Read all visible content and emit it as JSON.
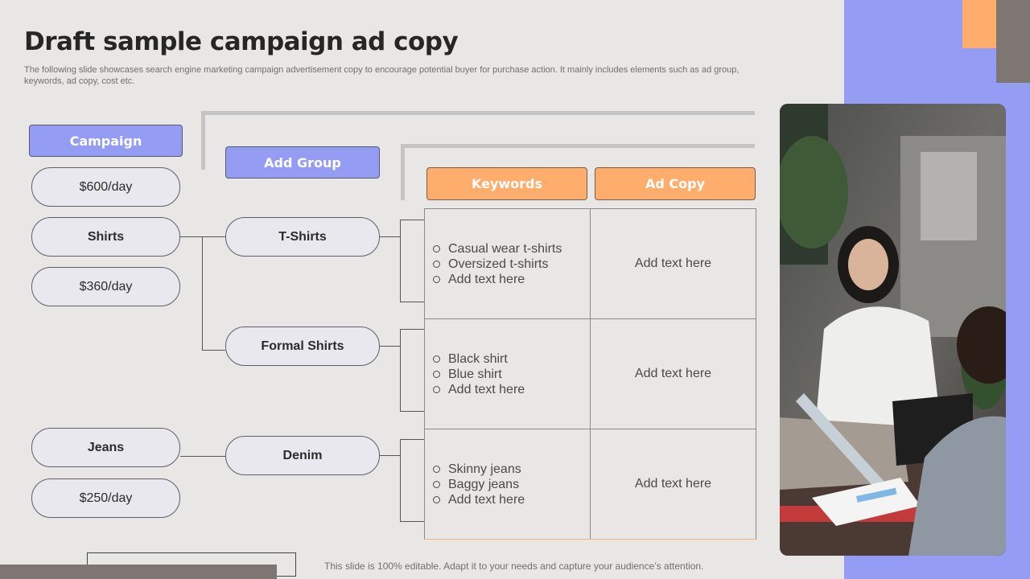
{
  "title": "Draft sample campaign ad copy",
  "subtitle": "The following slide showcases search engine marketing campaign advertisement copy to encourage potential buyer for purchase action. It mainly includes elements such as ad group, keywords, ad copy, cost etc.",
  "headers": {
    "campaign": "Campaign",
    "add_group": "Add Group",
    "keywords": "Keywords",
    "ad_copy": "Ad Copy"
  },
  "campaigns": [
    {
      "name": "Shirts",
      "budgets": [
        "$600/day",
        "$360/day"
      ]
    },
    {
      "name": "Jeans",
      "budgets": [
        "$250/day"
      ]
    }
  ],
  "ad_groups": [
    "T-Shirts",
    "Formal Shirts",
    "Denim"
  ],
  "rows": [
    {
      "keywords": [
        "Casual wear t-shirts",
        "Oversized t-shirts",
        "Add text here"
      ],
      "ad_copy": "Add text here"
    },
    {
      "keywords": [
        "Black shirt",
        "Blue shirt",
        "Add text here"
      ],
      "ad_copy": "Add text here"
    },
    {
      "keywords": [
        "Skinny jeans",
        "Baggy jeans",
        "Add text here"
      ],
      "ad_copy": "Add text here"
    }
  ],
  "footer_note": "This slide is 100% editable. Adapt it to your needs and capture your audience’s attention.",
  "colors": {
    "accent_blue": "#959cf4",
    "accent_orange": "#ffad6c",
    "accent_gray": "#7e7672"
  }
}
